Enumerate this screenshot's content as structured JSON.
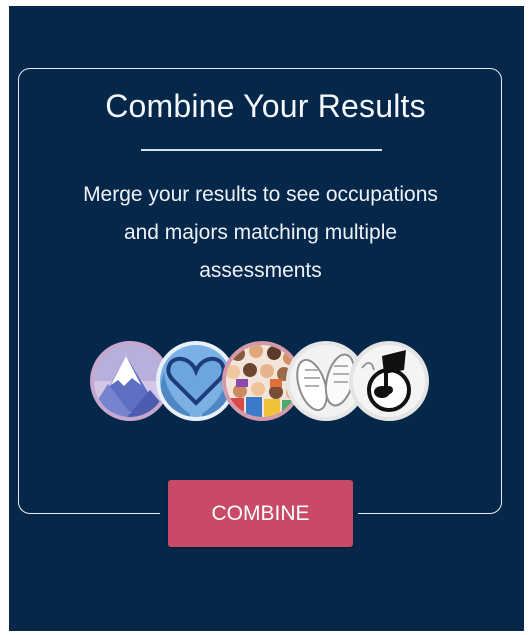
{
  "card": {
    "title": "Combine Your Results",
    "description": "Merge your results to see occupations and majors matching multiple assessments"
  },
  "assessments": [
    {
      "name": "mountain-icon"
    },
    {
      "name": "heart-hands-icon"
    },
    {
      "name": "people-crowd-icon"
    },
    {
      "name": "sneakers-icon"
    },
    {
      "name": "music-note-icon"
    }
  ],
  "buttons": {
    "combine_label": "COMBINE"
  },
  "colors": {
    "background": "#05284a",
    "button": "#c84a67",
    "text": "#f4f7fb"
  }
}
